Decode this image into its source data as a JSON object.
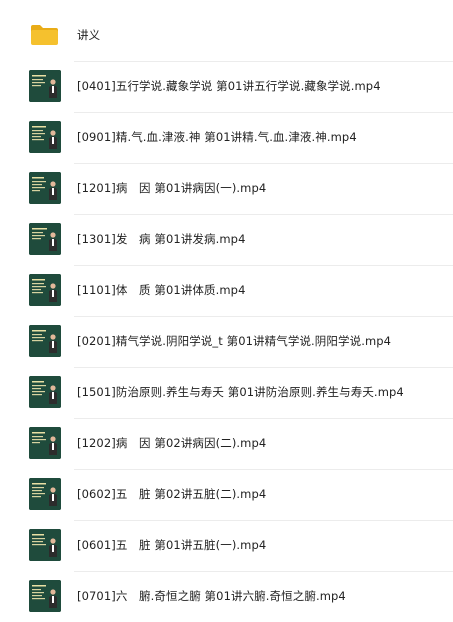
{
  "file_list": {
    "items": [
      {
        "name": "讲义",
        "icon": "folder-icon",
        "type": "folder"
      },
      {
        "name": "[0401]五行学说.藏象学说 第01讲五行学说.藏象学说.mp4",
        "icon": "video-thumbnail-icon",
        "type": "video"
      },
      {
        "name": "[0901]精.气.血.津液.神 第01讲精.气.血.津液.神.mp4",
        "icon": "video-thumbnail-icon",
        "type": "video"
      },
      {
        "name": "[1201]病　因 第01讲病因(一).mp4",
        "icon": "video-thumbnail-icon",
        "type": "video"
      },
      {
        "name": "[1301]发　病 第01讲发病.mp4",
        "icon": "video-thumbnail-icon",
        "type": "video"
      },
      {
        "name": "[1101]体　质 第01讲体质.mp4",
        "icon": "video-thumbnail-icon",
        "type": "video"
      },
      {
        "name": "[0201]精气学说.阴阳学说_t 第01讲精气学说.阴阳学说.mp4",
        "icon": "video-thumbnail-icon",
        "type": "video"
      },
      {
        "name": "[1501]防治原则.养生与寿夭 第01讲防治原则.养生与寿夭.mp4",
        "icon": "video-thumbnail-icon",
        "type": "video"
      },
      {
        "name": "[1202]病　因 第02讲病因(二).mp4",
        "icon": "video-thumbnail-icon",
        "type": "video"
      },
      {
        "name": "[0602]五　脏 第02讲五脏(二).mp4",
        "icon": "video-thumbnail-icon",
        "type": "video"
      },
      {
        "name": "[0601]五　脏 第01讲五脏(一).mp4",
        "icon": "video-thumbnail-icon",
        "type": "video"
      },
      {
        "name": "[0701]六　腑.奇恒之腑 第01讲六腑.奇恒之腑.mp4",
        "icon": "video-thumbnail-icon",
        "type": "video"
      }
    ]
  },
  "colors": {
    "folder": "#f5c12e",
    "folder_tab": "#e9ac17",
    "thumb_bg": "#1f4b3c",
    "thumb_text": "#e9e0a4",
    "text": "#222222",
    "separator": "#ececec"
  }
}
